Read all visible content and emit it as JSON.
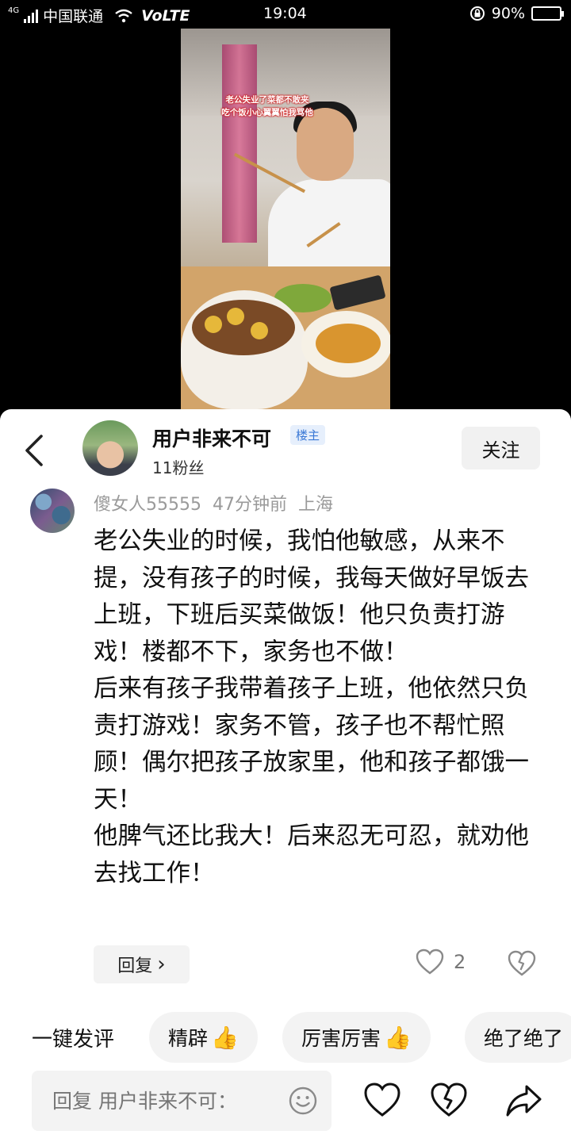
{
  "status_bar": {
    "network_type": "4G",
    "carrier": "中国联通",
    "volte": "VoLTE",
    "time": "19:04",
    "battery": "90%",
    "battery_level": 0.9
  },
  "video": {
    "caption_line1": "老公失业了菜都不敢夹",
    "caption_line2": "吃个饭小心翼翼怕我骂他"
  },
  "host": {
    "name": "用户非来不可",
    "tag": "楼主",
    "fans": "11粉丝",
    "follow_label": "关注"
  },
  "comment": {
    "author": "傻女人55555",
    "time": "47分钟前",
    "location": "上海",
    "paragraphs": [
      "老公失业的时候，我怕他敏感，从来不提，没有孩子的时候，我每天做好早饭去上班，下班后买菜做饭！他只负责打游戏！楼都不下，家务也不做！",
      "后来有孩子我带着孩子上班，他依然只负责打游戏！家务不管，孩子也不帮忙照顾！偶尔把孩子放家里，他和孩子都饿一天！",
      "他脾气还比我大！后来忍无可忍，就劝他去找工作！"
    ],
    "reply_label": "回复",
    "reply_chevron": "›",
    "like_count": "2"
  },
  "quick_reply": {
    "label": "一键发评",
    "chips": [
      "精辟",
      "厉害厉害",
      "绝了绝了"
    ],
    "chip_emoji": "👍"
  },
  "input_bar": {
    "placeholder": "回复 用户非来不可："
  },
  "icons": {
    "back": "chevron-left-icon",
    "like": "heart-outline-icon",
    "dislike": "broken-heart-icon",
    "emoji": "smiley-icon",
    "share": "share-arrow-icon"
  }
}
